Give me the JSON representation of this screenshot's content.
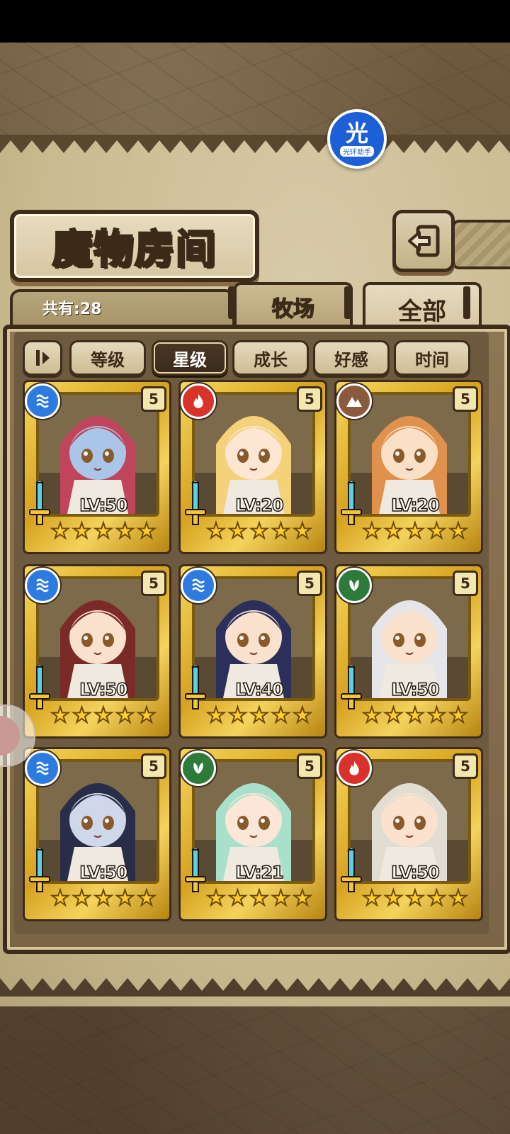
{
  "title": "魔物房间",
  "count_label": "共有:28",
  "tabs": [
    {
      "label": "牧场",
      "active": false
    },
    {
      "label": "全部",
      "active": true
    }
  ],
  "sort_buttons": [
    {
      "label": "等级",
      "active": false
    },
    {
      "label": "星级",
      "active": true
    },
    {
      "label": "成长",
      "active": false
    },
    {
      "label": "好感",
      "active": false
    },
    {
      "label": "时间",
      "active": false
    }
  ],
  "assistant": {
    "main": "光",
    "sub": "光环助手"
  },
  "monsters": [
    {
      "level": "LV:50",
      "element": "water-icon",
      "rank": "5",
      "stars": 5,
      "hair": "#c0445c",
      "skin": "#a9c6e8"
    },
    {
      "level": "LV:20",
      "element": "fire-icon",
      "rank": "5",
      "stars": 5,
      "hair": "#f3d27a",
      "skin": "#fde6d2"
    },
    {
      "level": "LV:20",
      "element": "earth-icon",
      "rank": "5",
      "stars": 5,
      "hair": "#e0924c",
      "skin": "#fbe0c8"
    },
    {
      "level": "LV:50",
      "element": "water-icon",
      "rank": "5",
      "stars": 5,
      "hair": "#7a2b28",
      "skin": "#fbe2cf"
    },
    {
      "level": "LV:40",
      "element": "water-icon",
      "rank": "5",
      "stars": 5,
      "hair": "#2b2f5a",
      "skin": "#fbe2cf"
    },
    {
      "level": "LV:50",
      "element": "wood-icon",
      "rank": "5",
      "stars": 5,
      "hair": "#e6e6ea",
      "skin": "#fbe2cf"
    },
    {
      "level": "LV:50",
      "element": "water-icon",
      "rank": "5",
      "stars": 5,
      "hair": "#2a2d48",
      "skin": "#cfd8ea"
    },
    {
      "level": "LV:21",
      "element": "wood-icon",
      "rank": "5",
      "stars": 5,
      "hair": "#a9e0cc",
      "skin": "#fbe6d8"
    },
    {
      "level": "LV:50",
      "element": "fire-icon",
      "rank": "5",
      "stars": 5,
      "hair": "#e2ddd2",
      "skin": "#fbe2cf"
    }
  ],
  "colors": {
    "water": "#2e7be0",
    "fire": "#d8322a",
    "earth": "#8a5a3c",
    "wood": "#2e7a3a",
    "gold": "#e6b934",
    "frame_dark": "#3d2c1c"
  }
}
